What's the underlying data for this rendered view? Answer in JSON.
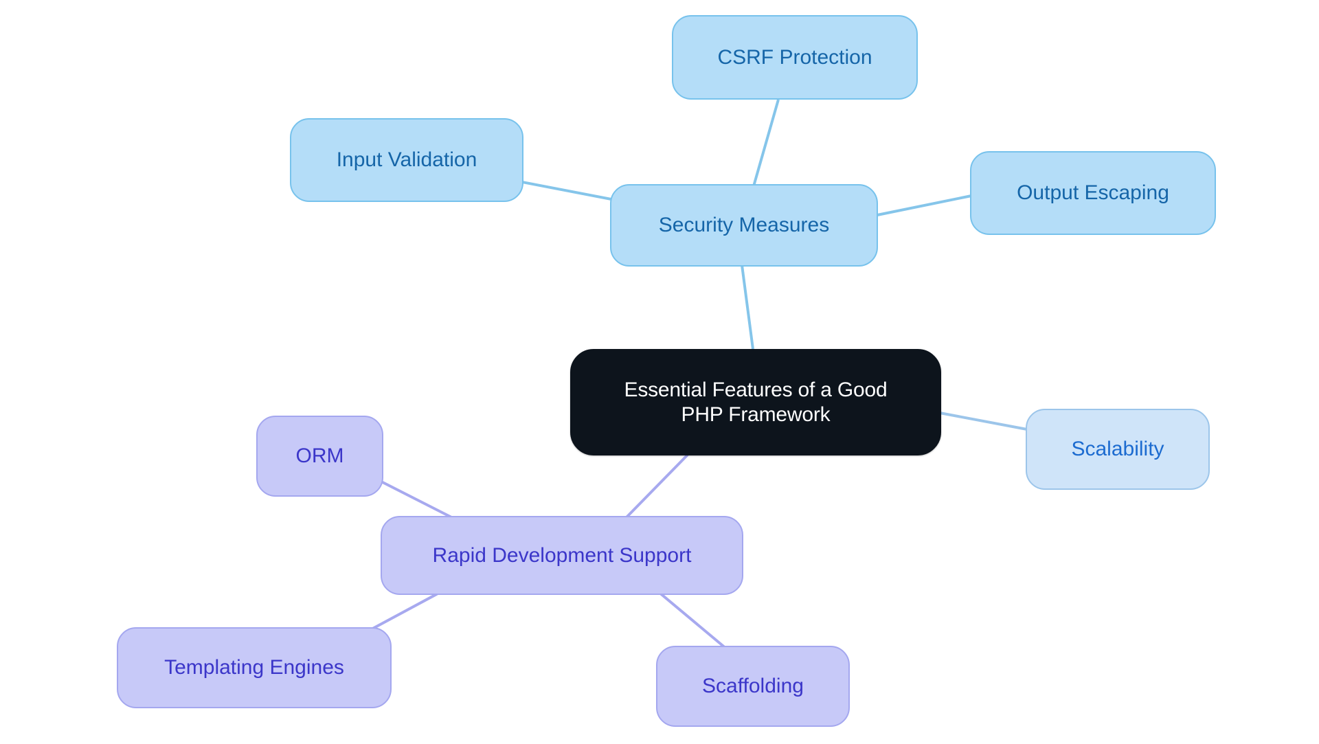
{
  "diagram": {
    "type": "mindmap",
    "title": "Essential Features of a Good PHP Framework",
    "background_color": "#ffffff",
    "palette": {
      "root_fill": "#0d141c",
      "root_text": "#ffffff",
      "security_fill": "#b4ddf8",
      "security_border": "#77c2ec",
      "security_text": "#1565a8",
      "scalability_fill": "#cfe4f9",
      "scalability_border": "#9cc5ea",
      "scalability_text": "#1c6bd0",
      "rapid_fill": "#c7c9f8",
      "rapid_border": "#a4a7ef",
      "rapid_text": "#3b36c9",
      "edge_blue": "#85c5ea",
      "edge_purple": "#a7a9ef"
    }
  },
  "nodes": {
    "root": {
      "label": "Essential Features of a Good\nPHP Framework",
      "branch": "root"
    },
    "security_measures": {
      "label": "Security Measures",
      "branch": "security"
    },
    "csrf_protection": {
      "label": "CSRF Protection",
      "branch": "security"
    },
    "input_validation": {
      "label": "Input Validation",
      "branch": "security"
    },
    "output_escaping": {
      "label": "Output Escaping",
      "branch": "security"
    },
    "scalability": {
      "label": "Scalability",
      "branch": "scalability"
    },
    "rapid_development_support": {
      "label": "Rapid Development Support",
      "branch": "rapid"
    },
    "orm": {
      "label": "ORM",
      "branch": "rapid"
    },
    "templating_engines": {
      "label": "Templating Engines",
      "branch": "rapid"
    },
    "scaffolding": {
      "label": "Scaffolding",
      "branch": "rapid"
    }
  },
  "edges": [
    {
      "from": "root",
      "to": "security_measures",
      "color": "#85c5ea"
    },
    {
      "from": "security_measures",
      "to": "csrf_protection",
      "color": "#85c5ea"
    },
    {
      "from": "security_measures",
      "to": "input_validation",
      "color": "#85c5ea"
    },
    {
      "from": "security_measures",
      "to": "output_escaping",
      "color": "#85c5ea"
    },
    {
      "from": "root",
      "to": "scalability",
      "color": "#9cc5ea"
    },
    {
      "from": "root",
      "to": "rapid_development_support",
      "color": "#a7a9ef"
    },
    {
      "from": "rapid_development_support",
      "to": "orm",
      "color": "#a7a9ef"
    },
    {
      "from": "rapid_development_support",
      "to": "templating_engines",
      "color": "#a7a9ef"
    },
    {
      "from": "rapid_development_support",
      "to": "scaffolding",
      "color": "#a7a9ef"
    }
  ]
}
